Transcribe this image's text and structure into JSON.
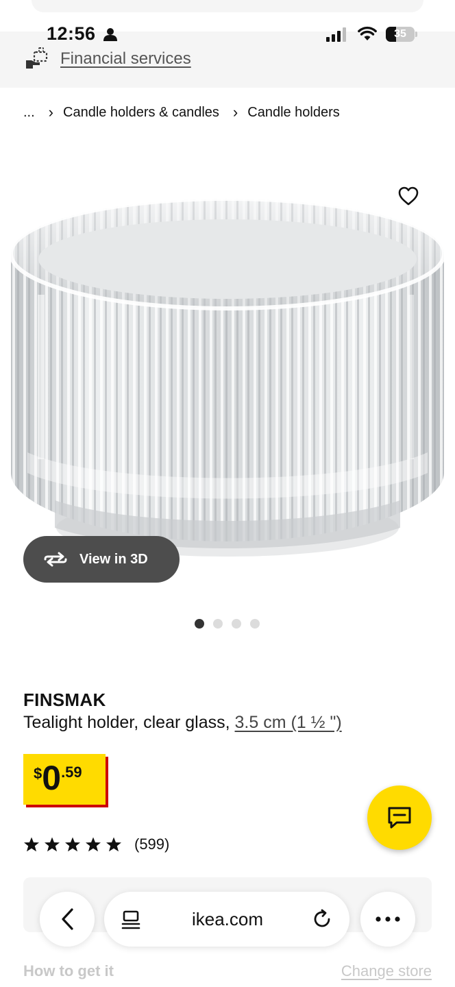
{
  "status_bar": {
    "time": "12:56",
    "battery_level": "35"
  },
  "header": {
    "financial_services_link": "Financial services"
  },
  "breadcrumb": {
    "items": [
      "...",
      "Candle holders & candles",
      "Candle holders"
    ],
    "separator": "›"
  },
  "gallery": {
    "view_3d_label": "View in 3D",
    "slide_count": 4,
    "active_slide": 1
  },
  "product": {
    "name": "FINSMAK",
    "description": "Tealight holder, clear glass, ",
    "size_link": "3.5 cm (1 ½ \")",
    "price": {
      "currency": "$",
      "integer": "0",
      "decimal": ".59"
    },
    "rating": {
      "stars": 5,
      "count": "(599)"
    }
  },
  "browser_bar": {
    "url": "ikea.com"
  },
  "footer": {
    "how_to_get_it": "How to get it",
    "change_store": "Change store"
  },
  "colors": {
    "ikea_yellow": "#ffdb00",
    "price_shadow_red": "#cc0008",
    "view3d_bg": "#4d4d4d",
    "header_bg": "#f5f5f5"
  }
}
